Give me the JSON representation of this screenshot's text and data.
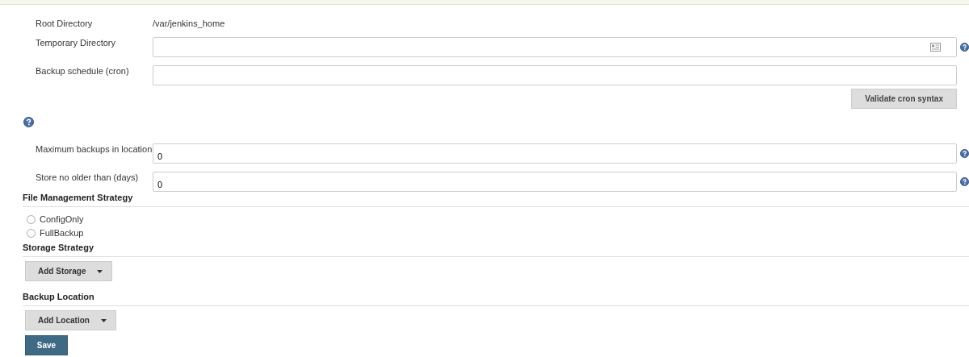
{
  "fields": [
    {
      "kind": "static",
      "label": "Root Directory",
      "value": "/var/jenkins_home"
    },
    {
      "kind": "input",
      "label": "Temporary Directory",
      "picker": true,
      "help": true
    },
    {
      "kind": "input",
      "label": "Backup schedule (cron)",
      "picker": false,
      "help": false
    },
    {
      "kind": "button",
      "label": "Validate cron syntax"
    },
    {
      "kind": "help"
    },
    {
      "kind": "input",
      "label": "Maximum backups in location",
      "value": "0",
      "picker": false,
      "help": true
    },
    {
      "kind": "input",
      "label": "Store no older than (days)",
      "value": "0",
      "picker": false,
      "help": true
    }
  ],
  "sections": [
    {
      "title": "File Management Strategy",
      "radios": [
        {
          "label": "ConfigOnly",
          "selected": false
        },
        {
          "label": "FullBackup",
          "selected": false
        }
      ]
    },
    {
      "title": "Storage Strategy",
      "dropdown": "Add Storage"
    },
    {
      "title": "Backup Location",
      "dropdown": "Add Location"
    }
  ],
  "save_button": "Save"
}
